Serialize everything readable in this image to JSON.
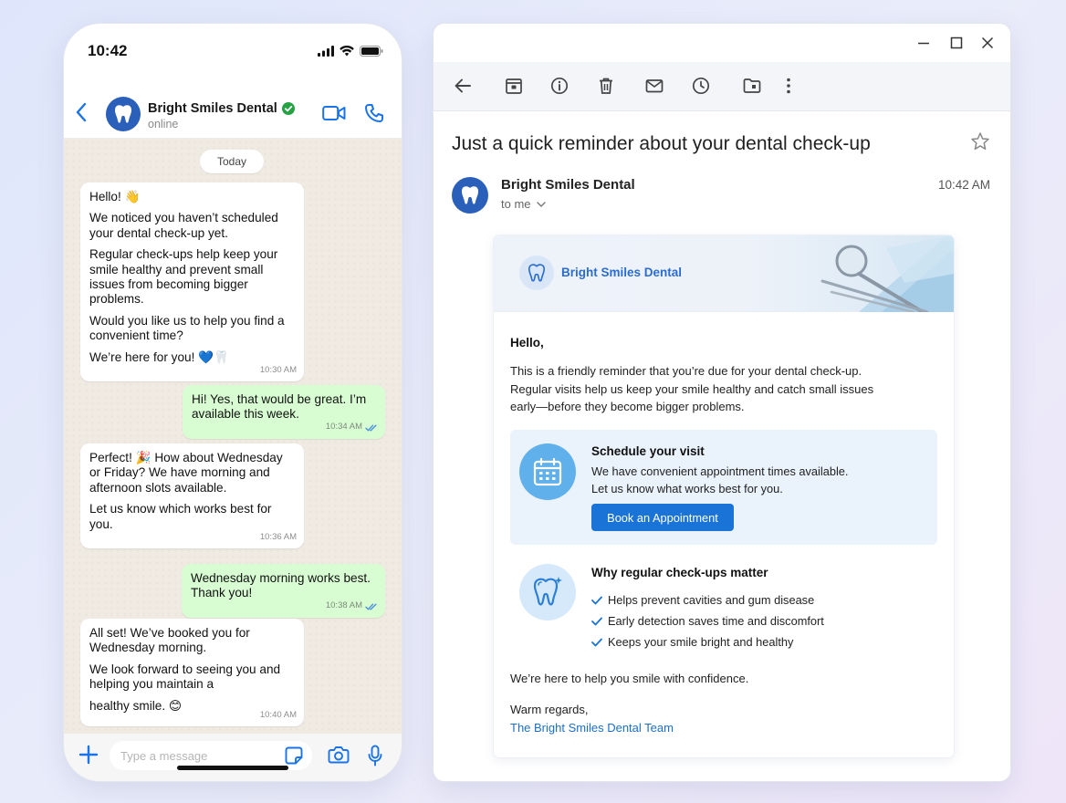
{
  "phone": {
    "status": {
      "time": "10:42"
    },
    "chat": {
      "contact_name": "Bright Smiles Dental",
      "contact_status": "online",
      "date_divider": "Today",
      "messages": [
        {
          "direction": "in",
          "paragraphs": [
            "Hello! 👋",
            "We noticed you haven’t scheduled your dental check-up yet.",
            "Regular check-ups help keep your smile healthy and prevent small issues from becoming bigger problems.",
            "Would you like us to help you find a convenient time?",
            "We’re here for you! 💙🦷"
          ],
          "time": "10:30 AM"
        },
        {
          "direction": "out",
          "paragraphs": [
            "Hi! Yes, that would be great. I’m available this week."
          ],
          "time": "10:34 AM"
        },
        {
          "direction": "in",
          "paragraphs": [
            "Perfect! 🎉 How about Wednesday or Friday? We have morning and afternoon slots available.",
            "Let us know which works best for you."
          ],
          "time": "10:36 AM"
        },
        {
          "direction": "out",
          "paragraphs": [
            "Wednesday morning works best. Thank you!"
          ],
          "time": "10:38 AM"
        },
        {
          "direction": "in",
          "paragraphs": [
            "All set! We’ve booked you for Wednesday morning.",
            "We look forward to seeing you and helping you maintain a",
            "healthy smile. 😊"
          ],
          "time": "10:40 AM"
        }
      ]
    },
    "composer": {
      "placeholder": "Type a message"
    },
    "icons": [
      "back-arrow-icon",
      "tooth-icon",
      "verified-icon",
      "video-call-icon",
      "phone-icon",
      "plus-icon",
      "sticker-icon",
      "camera-icon",
      "mic-icon",
      "double-check-icon"
    ]
  },
  "email": {
    "subject": "Just a quick reminder about your dental check-up",
    "sender": {
      "name": "Bright Smiles Dental",
      "to": "to me",
      "time": "10:42 AM"
    },
    "toolbar_icons": [
      "back-icon",
      "archive-icon",
      "info-icon",
      "delete-icon",
      "mark-unread-icon",
      "snooze-icon",
      "move-to-folder-icon",
      "more-icon"
    ],
    "card": {
      "brand": "Bright Smiles Dental",
      "greeting": "Hello,",
      "intro": "This is a friendly reminder that you’re due for your dental check-up. Regular visits help us keep your smile healthy and catch small issues early—before they become bigger problems.",
      "schedule": {
        "title": "Schedule your visit",
        "line1": "We have convenient appointment times available.",
        "line2": "Let us know what works best for you.",
        "button": "Book an Appointment"
      },
      "why": {
        "title": "Why regular check-ups matter",
        "items": [
          "Helps prevent cavities and gum disease",
          "Early detection saves time and discomfort",
          "Keeps your smile bright and healthy"
        ]
      },
      "closing": "We’re here to help you smile with confidence.",
      "regards": "Warm regards,",
      "signature": "The Bright Smiles Dental Team"
    }
  },
  "colors": {
    "brand_blue": "#2a5fba",
    "link_blue": "#1a73d6",
    "chat_out": "#d9fdd3",
    "verified_green": "#25a244"
  }
}
